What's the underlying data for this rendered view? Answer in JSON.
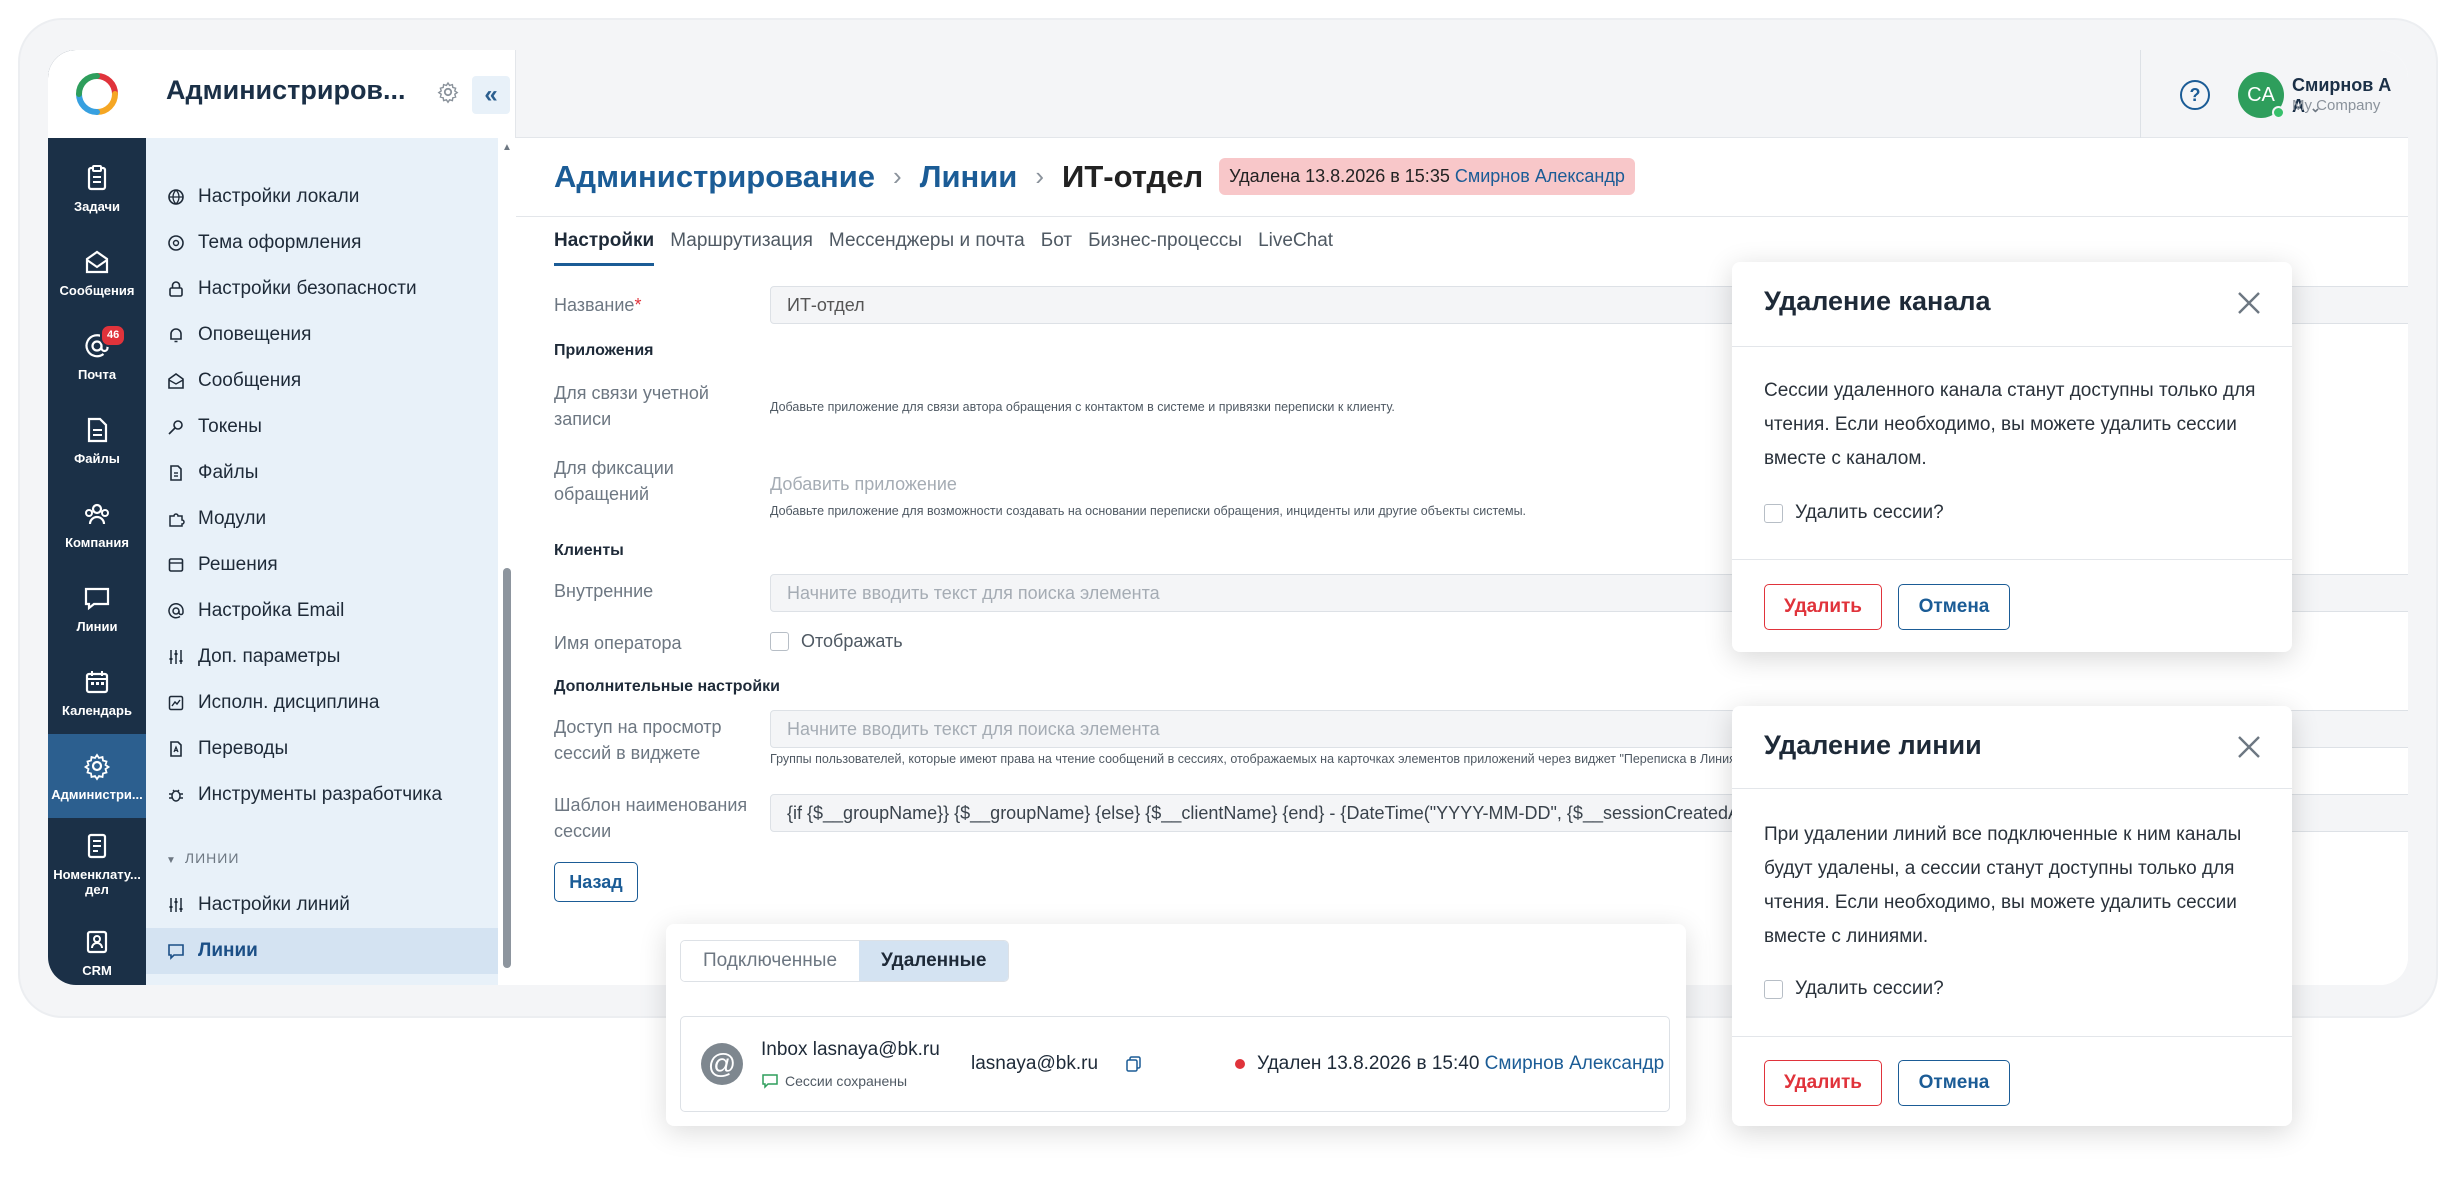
{
  "sidebar": {
    "title": "Администриров...",
    "items": [
      {
        "label": "Настройки локали",
        "icon": "globe-icon"
      },
      {
        "label": "Тема оформления",
        "icon": "palette-icon"
      },
      {
        "label": "Настройки безопасности",
        "icon": "lock-icon"
      },
      {
        "label": "Оповещения",
        "icon": "bell-icon"
      },
      {
        "label": "Сообщения",
        "icon": "mail-icon"
      },
      {
        "label": "Токены",
        "icon": "key-icon"
      },
      {
        "label": "Файлы",
        "icon": "file-icon"
      },
      {
        "label": "Модули",
        "icon": "puzzle-icon"
      },
      {
        "label": "Решения",
        "icon": "box-icon"
      },
      {
        "label": "Настройка Email",
        "icon": "at-icon"
      },
      {
        "label": "Доп. параметры",
        "icon": "sliders-icon"
      },
      {
        "label": "Исполн. дисциплина",
        "icon": "chart-icon"
      },
      {
        "label": "Переводы",
        "icon": "translate-icon"
      },
      {
        "label": "Инструменты разработчика",
        "icon": "bug-icon"
      }
    ],
    "group_label": "ЛИНИИ",
    "group_items": [
      {
        "label": "Настройки линий",
        "icon": "sliders-icon"
      },
      {
        "label": "Линии",
        "icon": "chat-icon"
      }
    ]
  },
  "rail": {
    "items": [
      {
        "label": "Задачи",
        "icon": "tasks-icon"
      },
      {
        "label": "Сообщения",
        "icon": "messages-icon"
      },
      {
        "label": "Почта",
        "icon": "mail-at-icon",
        "badge": "46"
      },
      {
        "label": "Файлы",
        "icon": "files-icon"
      },
      {
        "label": "Компания",
        "icon": "company-icon"
      },
      {
        "label": "Линии",
        "icon": "lines-icon"
      },
      {
        "label": "Календарь",
        "icon": "calendar-icon"
      },
      {
        "label": "Администри...",
        "icon": "admin-gear-icon"
      },
      {
        "label": "Номенклату... дел",
        "icon": "nomenclature-icon"
      },
      {
        "label": "CRM",
        "icon": "crm-icon"
      }
    ]
  },
  "topbar": {
    "user_initials": "CA",
    "user_name": "Смирнов А А",
    "user_company": "My Company"
  },
  "breadcrumb": {
    "root": "Администрирование",
    "section": "Линии",
    "current": "ИТ-отдел",
    "deleted_text": "Удалена 13.8.2026 в 15:35",
    "deleted_by": "Смирнов Александр"
  },
  "tabs": [
    "Настройки",
    "Маршрутизация",
    "Мессенджеры и почта",
    "Бот",
    "Бизнес-процессы",
    "LiveChat"
  ],
  "form": {
    "name_label": "Название",
    "name_required": "*",
    "name_value": "ИТ-отдел",
    "apps_section": "Приложения",
    "account_link_label": "Для связи учетной записи",
    "account_link_hint": "Добавьте приложение для связи автора обращения с контактом в системе и привязки переписки к клиенту.",
    "fixation_label": "Для фиксации обращений",
    "fixation_add": "Добавить приложение",
    "fixation_hint": "Добавьте приложение для возможности создавать на основании переписки обращения, инциденты или другие объекты системы.",
    "clients_section": "Клиенты",
    "internal_label": "Внутренние",
    "internal_placeholder": "Начните вводить текст для поиска элемента",
    "operator_label": "Имя оператора",
    "operator_checkbox": "Отображать",
    "extra_section": "Дополнительные настройки",
    "access_label": "Доступ на просмотр сессий в виджете",
    "access_placeholder": "Начните вводить текст для поиска элемента",
    "access_hint": "Группы пользователей, которые имеют права на чтение сообщений в сессиях, отображаемых на карточках элементов приложений через виджет \"Переписка в Линиях\".",
    "template_label": "Шаблон наименования сессии",
    "template_value": "{if {$__groupName}} {$__groupName} {else} {$__clientName} {end} - {DateTime(\"YYYY-MM-DD\", {$__sessionCreatedAt})}",
    "back_button": "Назад"
  },
  "dialog_channel": {
    "title": "Удаление канала",
    "text": "Сессии удаленного канала станут доступны только для чтения. Если необходимо, вы можете удалить сессии вместе с каналом.",
    "checkbox": "Удалить сессии?",
    "delete": "Удалить",
    "cancel": "Отмена"
  },
  "dialog_line": {
    "title": "Удаление линии",
    "text": "При удалении линий все подключенные к ним каналы будут удалены, а сессии станут доступны только для чтения. Если необходимо, вы можете удалить сессии вместе с линиями.",
    "checkbox": "Удалить сессии?",
    "delete": "Удалить",
    "cancel": "Отмена"
  },
  "channels": {
    "tab_connected": "Подключенные",
    "tab_deleted": "Удаленные",
    "item": {
      "name": "Inbox lasnaya@bk.ru",
      "sub": "Сессии сохранены",
      "email": "lasnaya@bk.ru",
      "status": "Удален 13.8.2026 в 15:40",
      "status_by": "Смирнов Александр"
    }
  },
  "colors": {
    "rail": "#1b3047",
    "accent": "#1b5c96",
    "danger": "#e0333b",
    "deleted_chip": "#f8c7c9"
  }
}
